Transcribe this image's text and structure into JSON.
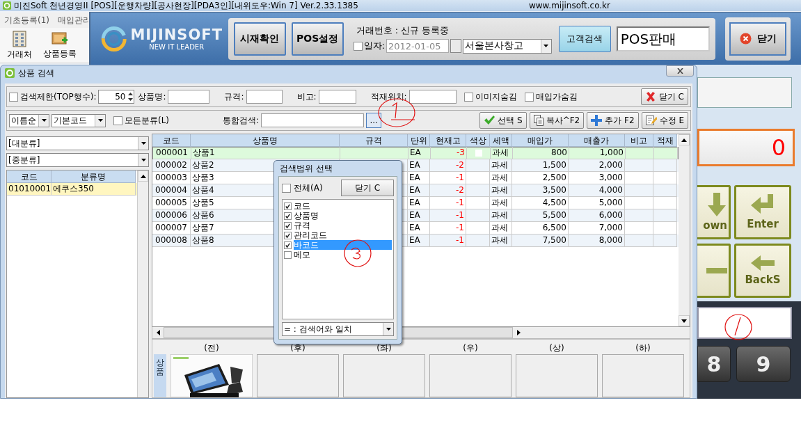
{
  "main_window": {
    "title": "미진Soft 천년경영II [POS][운행차량][공사현장][PDA3인][내위도우:Win 7] Ver.2.33.1385",
    "website": "www.mijinsoft.co.kr",
    "menu": [
      "기초등록(1)",
      "매입관리"
    ],
    "toolbar": [
      {
        "label": "거래처",
        "kind": "building"
      },
      {
        "label": "상품등록",
        "kind": "product"
      }
    ]
  },
  "pos": {
    "logo": {
      "name": "MIJINSOFT",
      "tagline": "NEW IT LEADER"
    },
    "buttons": [
      "시재확인",
      "POS설정"
    ],
    "transaction_label": "거래번호 : 신규 등록중",
    "date": {
      "label": "일자:",
      "checked": false,
      "value": "2012-01-05"
    },
    "warehouse": "서울본사창고",
    "customer_search": "고객검색",
    "mode": "POS판매",
    "close": "닫기",
    "display": "0",
    "keys": [
      {
        "label": "own",
        "kind": "down"
      },
      {
        "label": "Enter",
        "kind": "enter"
      },
      {
        "kind": "minus"
      },
      {
        "label": "BackS",
        "kind": "back"
      }
    ],
    "number_keys": [
      "8",
      "9"
    ]
  },
  "search_dialog": {
    "title": "상품 검색",
    "top_limit": {
      "label": "검색제한(TOP행수):",
      "checked": false,
      "value": "50"
    },
    "fields": [
      {
        "label": "상품명:"
      },
      {
        "label": "규격:"
      },
      {
        "label": "비고:"
      },
      {
        "label": "적재위치:"
      }
    ],
    "options": [
      {
        "label": "이미지숨김",
        "checked": false
      },
      {
        "label": "매입가숨김",
        "checked": false
      }
    ],
    "close_button": "닫기 C",
    "sort": "이름순",
    "code_type": "기본코드",
    "all_categories": {
      "label": "모든분류(L)",
      "checked": false
    },
    "integrated_search": {
      "label": "통합검색:"
    },
    "browse_button": "...",
    "actions": [
      {
        "label": "선택 S",
        "kind": "select"
      },
      {
        "label": "복사^F2",
        "kind": "copy"
      },
      {
        "label": "추가 F2",
        "kind": "add"
      },
      {
        "label": "수정 E",
        "kind": "edit"
      }
    ],
    "category_filters": [
      "[대분류]",
      "[중분류]"
    ],
    "category_table": {
      "columns": [
        "코드",
        "분류명"
      ],
      "rows": [
        {
          "code": "01010001",
          "name": "에쿠스350",
          "selected": true
        }
      ]
    },
    "product_table": {
      "columns": [
        "코드",
        "상품명",
        "규격",
        "단위",
        "현재고",
        "색상",
        "세액",
        "매입가",
        "매출가",
        "비고",
        "적재"
      ],
      "rows": [
        {
          "code": "000001",
          "name": "상품1",
          "unit": "EA",
          "stock": "-3",
          "color": "#ffffff",
          "tax": "과세",
          "purchase": "800",
          "sale": "1,000",
          "selected": true
        },
        {
          "code": "000002",
          "name": "상품2",
          "unit": "EA",
          "stock": "-2",
          "tax": "과세",
          "purchase": "1,500",
          "sale": "2,000",
          "selected": false
        },
        {
          "code": "000003",
          "name": "상품3",
          "unit": "EA",
          "stock": "-1",
          "tax": "과세",
          "purchase": "2,500",
          "sale": "3,000",
          "selected": false
        },
        {
          "code": "000004",
          "name": "상품4",
          "unit": "EA",
          "stock": "-2",
          "tax": "과세",
          "purchase": "3,500",
          "sale": "4,000",
          "selected": false
        },
        {
          "code": "000005",
          "name": "상품5",
          "unit": "EA",
          "stock": "-1",
          "tax": "과세",
          "purchase": "4,500",
          "sale": "5,000",
          "selected": false
        },
        {
          "code": "000006",
          "name": "상품6",
          "unit": "EA",
          "stock": "-1",
          "tax": "과세",
          "purchase": "5,500",
          "sale": "6,000",
          "selected": false
        },
        {
          "code": "000007",
          "name": "상품7",
          "unit": "EA",
          "stock": "-1",
          "tax": "과세",
          "purchase": "6,500",
          "sale": "7,000",
          "selected": false
        },
        {
          "code": "000008",
          "name": "상품8",
          "unit": "EA",
          "stock": "-1",
          "tax": "과세",
          "purchase": "7,500",
          "sale": "8,000",
          "selected": false
        }
      ]
    },
    "image_slots": {
      "side_label": "상품",
      "slots": [
        {
          "label": "(전)",
          "kind": "picture"
        },
        {
          "label": "(후)"
        },
        {
          "label": "(좌)"
        },
        {
          "label": "(우)"
        },
        {
          "label": "(상)"
        },
        {
          "label": "(하)"
        }
      ]
    }
  },
  "scope_popup": {
    "title": "검색범위 선택",
    "all": {
      "label": "전체(A)",
      "checked": false
    },
    "close_button": "닫기 C",
    "items": [
      {
        "label": "코드",
        "checked": true,
        "selected": false
      },
      {
        "label": "상품명",
        "checked": true,
        "selected": false
      },
      {
        "label": "규격",
        "checked": true,
        "selected": false
      },
      {
        "label": "관리코드",
        "checked": true,
        "selected": false
      },
      {
        "label": "바코드",
        "checked": true,
        "selected": true
      },
      {
        "label": "메모",
        "checked": false,
        "selected": false
      }
    ],
    "match_mode": "= : 검색어와 일치"
  }
}
